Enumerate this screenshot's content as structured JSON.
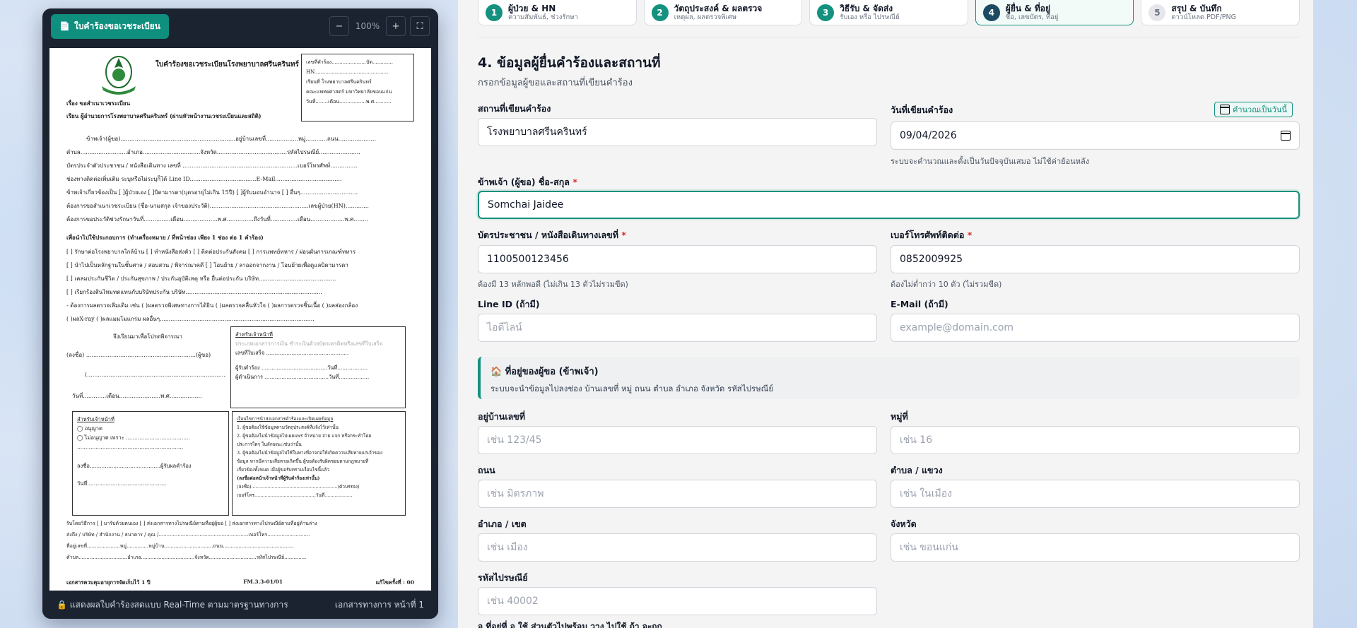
{
  "preview": {
    "title_button": "ใบคำร้องขอเวชระเบียน",
    "zoom_out": "−",
    "zoom_level": "100%",
    "zoom_in": "+",
    "fullscreen": "⛶",
    "footer_left": "🔒 แสดงผลใบคำร้องสดแบบ Real-Time ตามมาตรฐานทางการ",
    "footer_right": "เอกสารทางการ หน้าที่ 1",
    "paper": {
      "title": "ใบคำร้องขอเวชระเบียนโรงพยาบาลศรีนครินทร์",
      "box_lines": [
        "เลขที่คำร้อง......................บัด.............",
        "HN...............................................",
        "เรียนที่ โรงพยาบาลศรีนครินทร์",
        "คณะแพทยศาสตร์ มหาวิทยาลัยขอนแก่น",
        "วันที่........เดือน.................พ.ศ..........."
      ],
      "subject": "เรื่อง     ขอสำเนาเวชระเบียน",
      "to": "เรียน     ผู้อำนวยการโรงพยาบาลศรีนครินทร์ (ผ่านหัวหน้างานเวชระเบียนและสถิติ)",
      "lines": [
        "ข้าพเจ้า(ผู้ขอ)................................................................อยู่บ้านเลขที่..................หมู่............ถนน.....................",
        "ตำบล..........................อำเภอ................................จังหวัด.......................................รหัสไปรษณีย์.......................",
        "บัตรประจำตัวประชาชน / หนังสือเดินทาง เลขที่ ................................................................เบอร์โทรศัพท์...............",
        "ช่องทางติดต่อเพิ่มเติม ระบุหรือไม่ระบุก็ได้ Line ID.....................................E-Mail.....................................",
        "ข้าพเจ้าเกี่ยวข้องเป็น [ ]ผู้ป่วยเอง [ ]บิดามารดา(บุตรอายุไม่เกิน 15ปี) [ ]ผู้รับมอบอำนาจ [ ] อื่นๆ................................",
        "ต้องการขอสำเนาเวชระเบียน (ชื่อ-นามสกุล เจ้าของประวัติ).......................................................เลขผู้ป่วย(HN).............",
        "ต้องการขอประวัติช่วงรักษาวันที่...............เดือน...................พ.ศ...............ถึงวันที่...............เดือน...................พ.ศ........"
      ],
      "purpose_title": "เพื่อนำไปใช้ประกอบการ (ทำเครื่องหมาย / ที่หน้าช่อง เพียง 1 ช่อง ต่อ 1 คำร้อง)",
      "purposes": [
        "[ ] รักษาต่อโรงพยาบาลใกล้บ้าน   [ ] ทำหนังสือส่งตัว   [ ] ติดต่อประกันสังคม   [ ] การแพทย์ทหาร / ผ่อนผันการเกณฑ์ทหาร",
        "[ ] นำไปเป็นหลักฐานในชั้นศาล / สอบสวน / พิจารณาคดี   [ ] โอนย้าย / ลาออกจากงาน / โอนย้ายเพื่อดูแลบิดามารดา",
        "[ ] เคลมประกันชีวิต / ประกันสุขภาพ / ประกันอุบัติเหตุ หรือ ยื่นต่อประกัน บริษัท...........................................",
        "[ ] เรียกร้องสินไหมทดแทนกับบริษัทประกัน บริษัท............................................................................",
        " - ต้องการผลตรวจเพิ่มเติม เช่น ( )ผลตรวจพิเศษทางการได้ยิน ( )ผลตรวจคลื่นหัวใจ ( )ผลการตรวจชิ้นเนื้อ ( )ผลส่องกล้อง",
        "( )ผลX-ray ( )ผลแมมโมแกรม ผลอื่นๆ......................................................................................"
      ],
      "sign_please": "จึงเรียนมาเพื่อโปรดพิจารณา",
      "sign_line": "(ลงชื่อ) .............................................................(ผู้ขอ)",
      "sign_paren": "(...............................................................................)",
      "sign_date": "วันที่.............เดือน.......................พ.ศ..................",
      "officer_box": [
        "สำหรับเจ้าหน้าที่",
        "ประเภทเอกสารการเงิน  ชำระเงินด้วยบัตรเครดิตหรือเลขที่ใบเสร็จ",
        "เลขที่ใบเสร็จ .................................................",
        "ผู้รับคำร้อง .......................................วันที่..................",
        "ผู้ดำเนินการ ......................................วันที่.................."
      ],
      "approve_box": [
        "สำหรับเจ้าหน้าที่",
        "◯ อนุญาต",
        "◯ ไม่อนุญาต เพราะ ......................................",
        "...............................................................",
        "ลงชื่อ..........................................ผู้รับผลคำร้อง",
        "วันที่..............................................."
      ],
      "terms_box": [
        "เงื่อนไขการนำส่งเอกสารคำร้องและเปิดเผยข้อมูล",
        "1. ผู้ขอต้องใช้ข้อมูลตามวัตถุประสงค์ที่แจ้งไว้เท่านั้น",
        "2. ผู้ขอต้องไม่นำข้อมูลไปเผยแพร่ จำหน่าย จ่าย แจก หรือกระทำโดย",
        "ประการใดๆ ในลักษณะเช่นว่านั้น",
        "3. ผู้ขอต้องไม่นำข้อมูลไปใช้ในทางที่อาจก่อให้เกิดความเสียหายแก่เจ้าของ",
        "ข้อมูล หากมีความเสียหายเกิดขึ้น ผู้ขอต้องรับผิดชอบตามกฎหมายที่",
        "เกี่ยวข้องทั้งหมด  เมื่อผู้ขอรับทราบเงื่อนไขนี้แล้ว",
        "(ลงชื่อต่อหน้าเจ้าหน้าที่ผู้รับคำร้องเท่านั้น)",
        "(ลงชื่อ)...........................................................(ตัวบรรจง)",
        "เบอร์โทร..........................................วันที่..................."
      ],
      "delivery": "รับโดยวิธีการ    [ ] มารับด้วยตนเอง   [ ] ส่งเอกสารทางไปรษณีย์ตามที่อยู่ผู้ขอ   [ ] ส่งเอกสารทางไปรษณีย์ตามที่อยู่ด้านล่าง",
      "delivery_lines": [
        "ส่งถึง / บริษัท / สำนักงาน / ธนาคาร / คุณ /.........................................................เบอร์โทร...........................",
        "ที่อยู่เลขที่.....................หมู่..............หมู่บ้าน...............................ถนน.............................................",
        "ตำบล...............................อำเภอ..................................จังหวัด..............................รหัสไปรษณีย์.............."
      ],
      "footer_left": "เอกสารควบคุมอายุการจัดเก็บไว้ 1 ปี",
      "footer_mid": "FM.3.3-01/01",
      "footer_right": "แก้ไขครั้งที่ : 00"
    }
  },
  "steps": [
    {
      "num": "1",
      "title": "ผู้ป่วย & HN",
      "sub": "ความสัมพันธ์, ช่วงรักษา",
      "state": "done"
    },
    {
      "num": "2",
      "title": "วัตถุประสงค์ & ผลตรวจ",
      "sub": "เหตุผล, ผลตรวจพิเศษ",
      "state": "done"
    },
    {
      "num": "3",
      "title": "วิธีรับ & จัดส่ง",
      "sub": "รับเอง หรือ ไปรษณีย์",
      "state": "done"
    },
    {
      "num": "4",
      "title": "ผู้ยื่น & ที่อยู่",
      "sub": "ชื่อ, เลขบัตร, ที่อยู่",
      "state": "active"
    },
    {
      "num": "5",
      "title": "สรุป & บันทึก",
      "sub": "ดาวน์โหลด PDF/PNG",
      "state": "pending"
    }
  ],
  "section": {
    "title": "4. ข้อมูลผู้ยื่นคำร้องและสถานที่",
    "subtitle": "กรอกข้อมูลผู้ขอและสถานที่เขียนคำร้อง"
  },
  "fields": {
    "place": {
      "label": "สถานที่เขียนคำร้อง",
      "value": "โรงพยาบาลศรีนครินทร์"
    },
    "date": {
      "label": "วันที่เขียนคำร้อง",
      "value": "09/04/2026",
      "hint": "ระบบจะคำนวณและตั้งเป็นวันปัจจุบันเสมอ ไม่ใช้ค่าย้อนหลัง",
      "calc_button": "คำนวณเป็นวันนี้"
    },
    "name": {
      "label": "ข้าพเจ้า (ผู้ขอ) ชื่อ-สกุล",
      "value": "Somchai Jaidee"
    },
    "id_card": {
      "label": "บัตรประชาชน / หนังสือเดินทางเลขที่",
      "value": "1100500123456",
      "hint": "ต้องมี 13 หลักพอดี (ไม่เกิน 13 ตัวไม่รวมขีด)"
    },
    "phone": {
      "label": "เบอร์โทรศัพท์ติดต่อ",
      "value": "0852009925",
      "hint": "ต้องไม่ต่ำกว่า 10 ตัว (ไม่รวมขีด)"
    },
    "line": {
      "label": "Line ID (ถ้ามี)",
      "placeholder": "ไอดีไลน์"
    },
    "email": {
      "label": "E-Mail (ถ้ามี)",
      "placeholder": "example@domain.com"
    },
    "house_no": {
      "label": "อยู่บ้านเลขที่",
      "placeholder": "เช่น 123/45"
    },
    "moo": {
      "label": "หมู่ที่",
      "placeholder": "เช่น 16"
    },
    "road": {
      "label": "ถนน",
      "placeholder": "เช่น มิตรภาพ"
    },
    "tambon": {
      "label": "ตำบล / แขวง",
      "placeholder": "เช่น ในเมือง"
    },
    "amphoe": {
      "label": "อำเภอ / เขต",
      "placeholder": "เช่น เมือง"
    },
    "province": {
      "label": "จังหวัด",
      "placeholder": "เช่น ขอนแก่น"
    },
    "postcode": {
      "label": "รหัสไปรษณีย์",
      "placeholder": "เช่น 40002"
    }
  },
  "address_box": {
    "title": "🏠 ที่อยู่ของผู้ขอ (ข้าพเจ้า)",
    "desc": "ระบบจะนำข้อมูลไปลงช่อง บ้านเลขที่ หมู่ ถนน ตำบล อำเภอ จังหวัด รหัสไปรษณีย์"
  },
  "truncated_text": "อ ที่อยู่ที่ อ ใช้ ส่วนตัวไปพร้อม วาง ไปใช้ ถ้า จะถูก"
}
